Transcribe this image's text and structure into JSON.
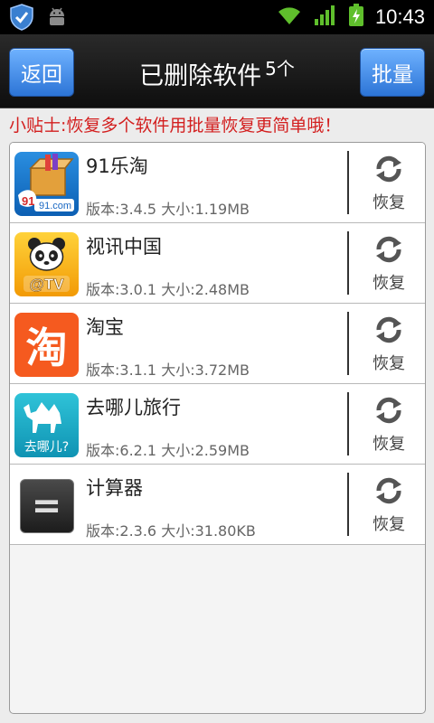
{
  "status_bar": {
    "time": "10:43",
    "icons": [
      "shield-check-icon",
      "android-icon",
      "wifi-icon",
      "signal-icon",
      "battery-charging-icon"
    ]
  },
  "header": {
    "back_label": "返回",
    "title": "已删除软件",
    "count": "5个",
    "batch_label": "批量"
  },
  "tip": "小贴士:恢复多个软件用批量恢复更简单哦！",
  "apps": [
    {
      "name": "91乐淘",
      "version_size": "版本:3.4.5 大小:1.19MB",
      "restore_label": "恢复"
    },
    {
      "name": "视讯中国",
      "version_size": "版本:3.0.1 大小:2.48MB",
      "restore_label": "恢复"
    },
    {
      "name": "淘宝",
      "version_size": "版本:3.1.1 大小:3.72MB",
      "restore_label": "恢复"
    },
    {
      "name": "去哪儿旅行",
      "version_size": "版本:6.2.1 大小:2.59MB",
      "restore_label": "恢复"
    },
    {
      "name": "计算器",
      "version_size": "版本:2.3.6 大小:31.80KB",
      "restore_label": "恢复"
    }
  ],
  "icon_text": {
    "letao": "91.com",
    "shixun": "@TV",
    "taobao": "淘",
    "qunar": "去哪儿?",
    "calculator": "="
  }
}
